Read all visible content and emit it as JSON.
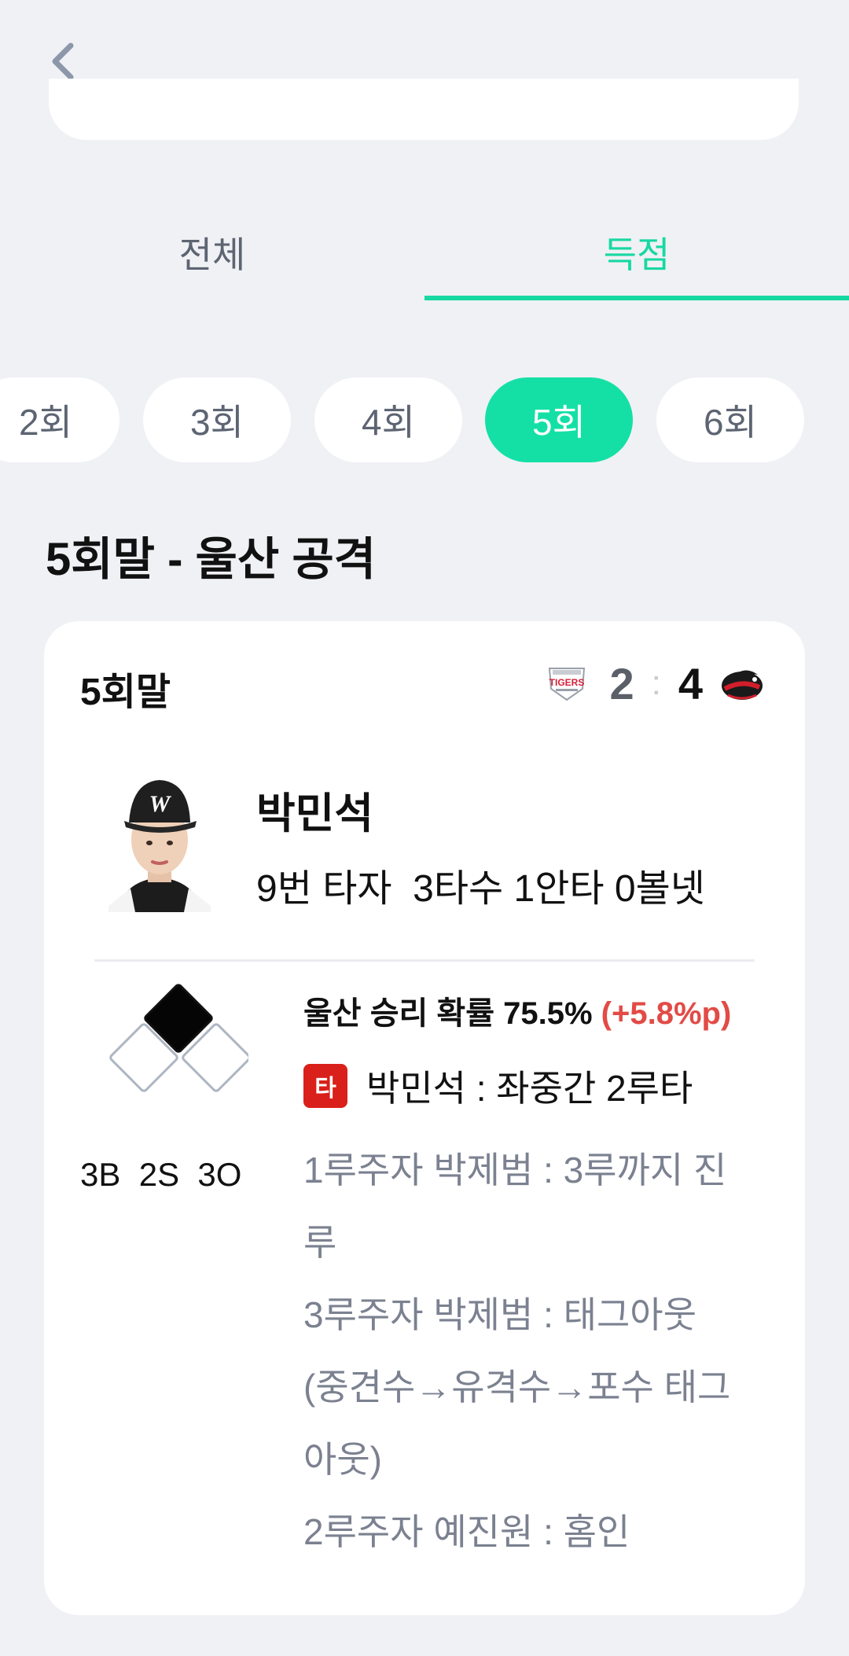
{
  "nav": {
    "back_icon": "chevron-left-icon"
  },
  "tabs": [
    {
      "label": "전체",
      "active": false
    },
    {
      "label": "득점",
      "active": true
    }
  ],
  "innings": [
    {
      "label": "2회",
      "active": false
    },
    {
      "label": "3회",
      "active": false
    },
    {
      "label": "4회",
      "active": false
    },
    {
      "label": "5회",
      "active": true
    },
    {
      "label": "6회",
      "active": false
    }
  ],
  "section_title": "5회말 - 울산 공격",
  "card": {
    "inning": "5회말",
    "home_logo_text": "TIGERS",
    "home_score": "2",
    "separator": ":",
    "away_score": "4",
    "player_name": "박민석",
    "player_stats": "9번 타자  3타수 1안타 0볼넷",
    "bases": {
      "first": false,
      "second": true,
      "third": false
    },
    "count": "3B  2S  3O",
    "win_prob_text": "울산 승리 확률 75.5% ",
    "win_prob_delta": "(+5.8%p)",
    "hit_badge": "타",
    "hit_text": "박민석 : 좌중간 2루타",
    "runner_events": [
      "1루주자 박제범 : 3루까지 진",
      "루",
      "3루주자 박제범 : 태그아웃",
      "(중견수→유격수→포수 태그",
      "아웃)",
      "2루주자 예진원 : 홈인"
    ]
  },
  "colors": {
    "accent": "#14e0a6",
    "background": "#f0f1f5",
    "delta_red": "#e24b46",
    "hit_badge": "#d9201a"
  }
}
